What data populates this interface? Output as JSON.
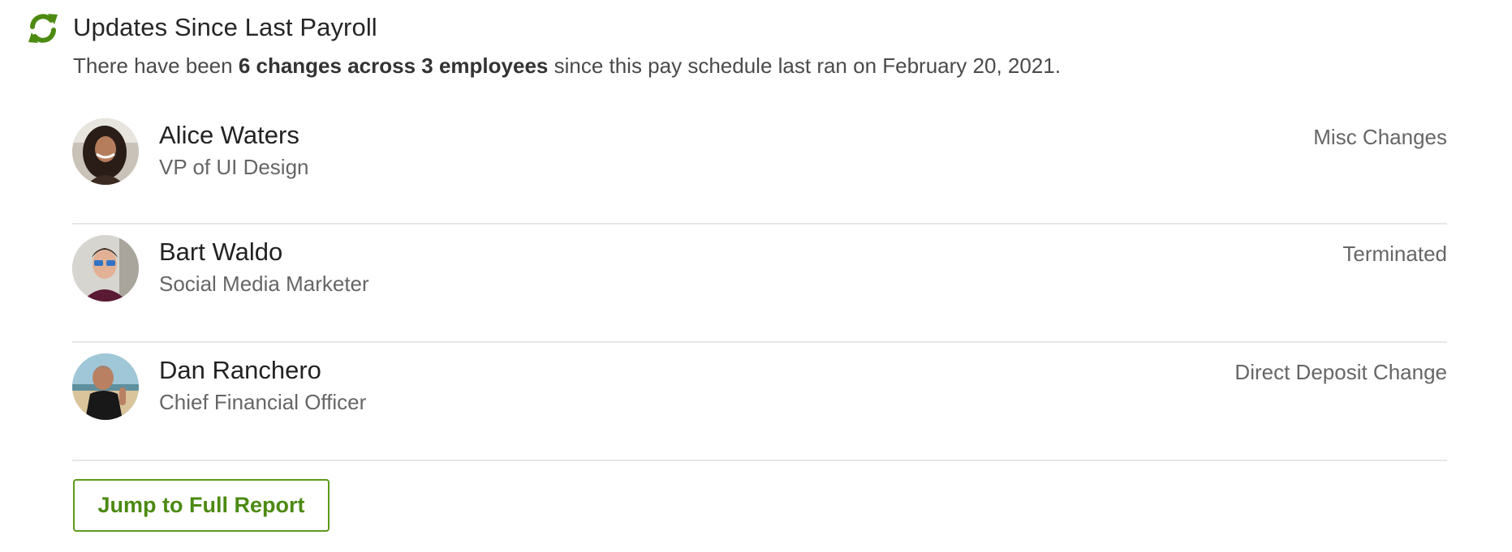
{
  "header": {
    "icon": "sync-icon",
    "accent_color": "#4c8a12",
    "title": "Updates Since Last Payroll"
  },
  "summary": {
    "prefix": "There have been ",
    "changes_bold": "6 changes across 3 employees",
    "suffix": " since this pay schedule last ran on February 20, 2021."
  },
  "employees": [
    {
      "name": "Alice Waters",
      "role": "VP of UI Design",
      "change": "Misc Changes",
      "avatar": "avatar-alice"
    },
    {
      "name": "Bart Waldo",
      "role": "Social Media Marketer",
      "change": "Terminated",
      "avatar": "avatar-bart"
    },
    {
      "name": "Dan Ranchero",
      "role": "Chief Financial Officer",
      "change": "Direct Deposit Change",
      "avatar": "avatar-dan"
    }
  ],
  "actions": {
    "full_report_label": "Jump to Full Report"
  }
}
